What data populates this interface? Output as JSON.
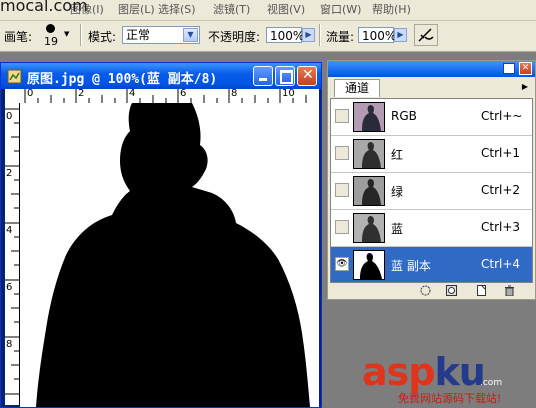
{
  "site_watermark": "mocal.com",
  "menu": {
    "items": [
      "编辑(E)",
      "图像(I)",
      "图层(L)",
      "选择(S)",
      "滤镜(T)",
      "视图(V)",
      "窗口(W)",
      "帮助(H)"
    ]
  },
  "options_bar": {
    "brush_label": "画笔:",
    "brush_size": "19",
    "mode_label": "模式:",
    "mode_value": "正常",
    "opacity_label": "不透明度:",
    "opacity_value": "100%",
    "flow_label": "流量:",
    "flow_value": "100%"
  },
  "document": {
    "title": "原图.jpg @ 100%(蓝 副本/8)",
    "ruler_top_labels": [
      "0",
      "2",
      "4",
      "6",
      "8",
      "10"
    ],
    "ruler_left_labels": [
      "0",
      "2",
      "4",
      "6",
      "8"
    ]
  },
  "channels_panel": {
    "tab_label": "通道",
    "channels": [
      {
        "name": "RGB",
        "shortcut": "Ctrl+~",
        "selected": false,
        "visible": false
      },
      {
        "name": "红",
        "shortcut": "Ctrl+1",
        "selected": false,
        "visible": false
      },
      {
        "name": "绿",
        "shortcut": "Ctrl+2",
        "selected": false,
        "visible": false
      },
      {
        "name": "蓝",
        "shortcut": "Ctrl+3",
        "selected": false,
        "visible": false
      },
      {
        "name": "蓝 副本",
        "shortcut": "Ctrl+4",
        "selected": true,
        "visible": true
      }
    ]
  },
  "branding": {
    "logo_part1": "asp",
    "logo_part2": "ku",
    "logo_suffix": ".com",
    "tagline": "免费网站源码下载站!"
  },
  "colors": {
    "titlebar": "#0055e5",
    "selection": "#316ac5",
    "workspace": "#7d7d7d",
    "brand_red": "#e0341c",
    "brand_blue": "#243a8c"
  }
}
